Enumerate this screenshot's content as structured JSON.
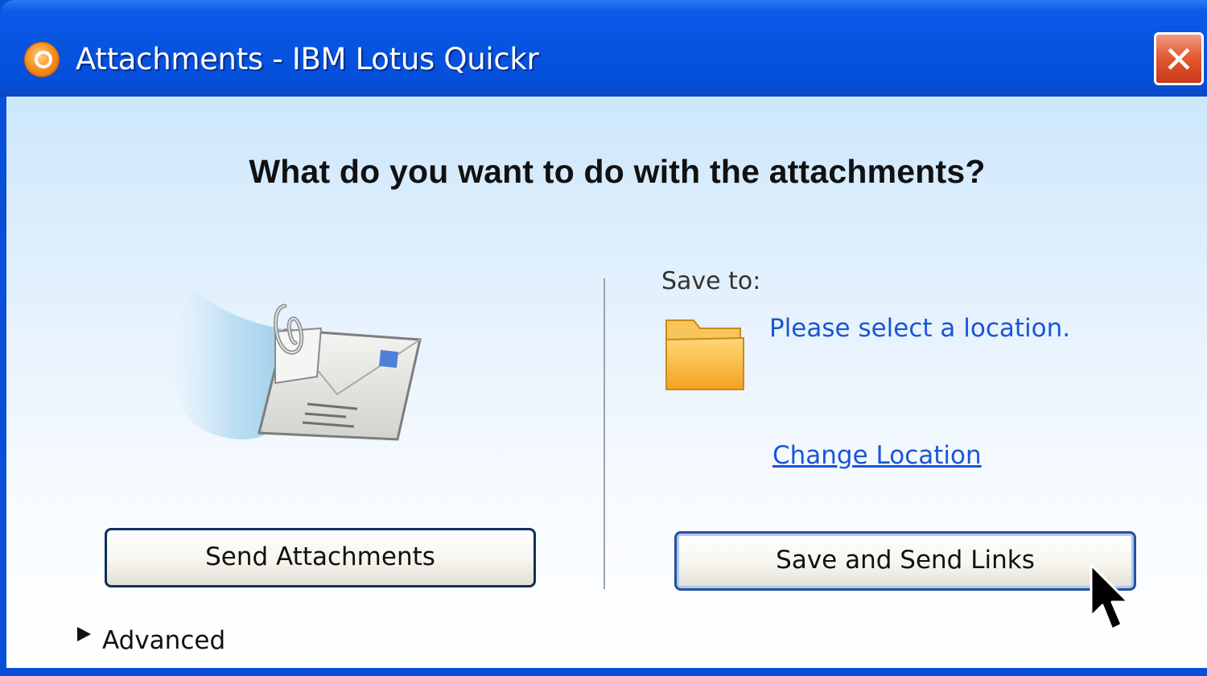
{
  "window": {
    "title": "Attachments - IBM Lotus Quickr",
    "close_glyph": "✕"
  },
  "dialog": {
    "question": "What do you want to do with the attachments?",
    "send_attachments_label": "Send Attachments",
    "save_to_label": "Save to:",
    "location_text": "Please select a location.",
    "change_location_label": "Change Location",
    "save_send_links_label": "Save and Send Links",
    "advanced_label": "Advanced"
  },
  "icons": {
    "app": "quickr-app-icon",
    "close": "close-icon",
    "illustration": "email-attachment-icon",
    "folder": "folder-icon",
    "expander": "triangle-right-icon",
    "cursor": "mouse-pointer-icon"
  },
  "colors": {
    "titlebar": "#0654e0",
    "close_button": "#e35b33",
    "link": "#1a55d8",
    "client_top": "#cde7fb"
  }
}
